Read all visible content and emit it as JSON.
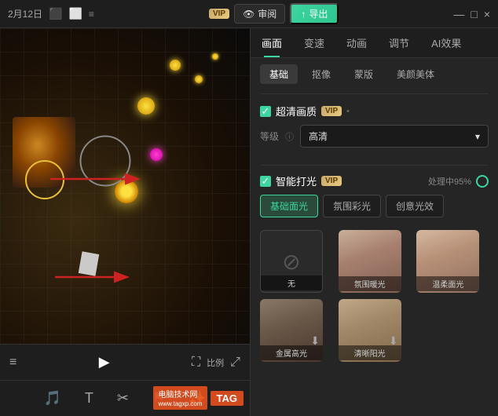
{
  "topbar": {
    "date": "2月12日",
    "vip_label": "VIP",
    "review_label": "审阅",
    "export_label": "导出",
    "win_minimize": "—",
    "win_maximize": "□",
    "win_close": "×"
  },
  "tabs": {
    "items": [
      "画面",
      "变速",
      "动画",
      "调节",
      "AI效果"
    ]
  },
  "subtabs": {
    "items": [
      "基础",
      "抠像",
      "蒙版",
      "美颜美体"
    ]
  },
  "hd_section": {
    "checkbox_checked": true,
    "title": "超清画质",
    "vip_label": "VIP",
    "level_label": "等级",
    "info_icon": "ⓘ",
    "level_value": "高清",
    "dropdown_arrow": "▾"
  },
  "smart_light": {
    "checkbox_checked": true,
    "title": "智能打光",
    "vip_label": "VIP",
    "processing_label": "处理中95%",
    "light_tabs": [
      "基础面光",
      "氛围彩光",
      "创意光效"
    ]
  },
  "light_items": [
    {
      "id": "none",
      "label": "无",
      "type": "no-effect"
    },
    {
      "id": "ambient",
      "label": "氛围暖光",
      "type": "face"
    },
    {
      "id": "warm",
      "label": "温柔面光",
      "type": "face"
    },
    {
      "id": "golden",
      "label": "金属高光",
      "type": "face-dark",
      "has_download": true
    },
    {
      "id": "clear",
      "label": "清晰阳光",
      "type": "face",
      "has_download": true
    }
  ],
  "bottom_controls": {
    "scale_label": "比例",
    "fullscreen": "⛶"
  },
  "toolbar": {
    "items": [
      "🎵",
      "🔤",
      "🎬",
      "🖼",
      "✨"
    ]
  },
  "watermark": {
    "site": "电脑技术网",
    "sub_site": "www.tagxp.com",
    "tag": "TAG"
  }
}
